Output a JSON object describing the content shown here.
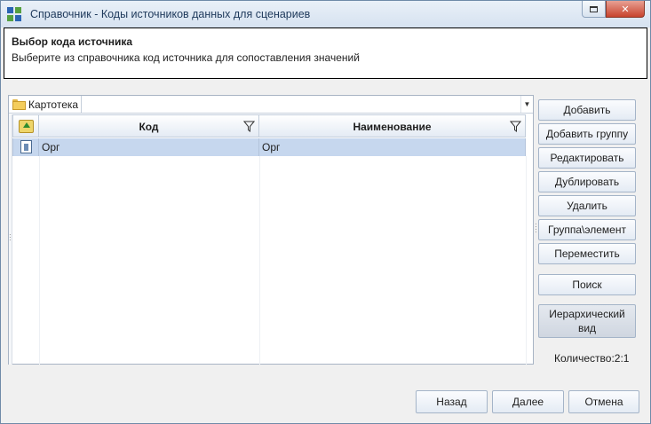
{
  "window": {
    "title": "Справочник - Коды источников данных для сценариев",
    "close_glyph": "✕"
  },
  "header": {
    "title": "Выбор кода источника",
    "description": "Выберите из справочника код источника для сопоставления значений"
  },
  "path": {
    "label": "Картотека",
    "dropdown_glyph": "▼"
  },
  "table": {
    "columns": [
      "Код",
      "Наименование"
    ],
    "rows": [
      {
        "kod": "Орг",
        "name": "Орг"
      }
    ]
  },
  "side_buttons": {
    "add": "Добавить",
    "add_group": "Добавить группу",
    "edit": "Редактировать",
    "duplicate": "Дублировать",
    "delete": "Удалить",
    "group_element": "Группа\\элемент",
    "move": "Переместить",
    "search": "Поиск",
    "hier_line1": "Иерархический",
    "hier_line2": "вид"
  },
  "count_text": "Количество:2:1",
  "bottom_buttons": {
    "back": "Назад",
    "next": "Далее",
    "cancel": "Отмена"
  }
}
